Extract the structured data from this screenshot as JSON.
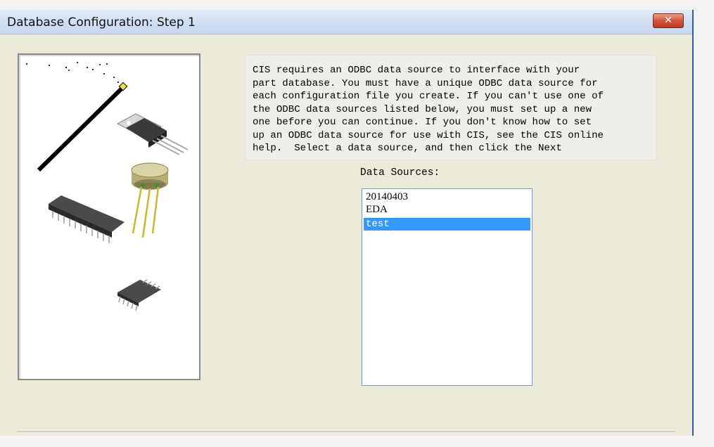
{
  "window": {
    "title": "Database Configuration: Step 1",
    "close_symbol": "✕"
  },
  "illustration": {
    "icons": [
      "magic-wand-icon",
      "to220-transistor-icon",
      "to5-transistor-icon",
      "dip-ic-chip-icon",
      "soic-chip-icon"
    ]
  },
  "description": {
    "lines": [
      "CIS requires an ODBC data source to interface with your",
      "part database. You must have a unique ODBC data source for",
      "each configuration file you create. If you can't use one of",
      "the ODBC data sources listed below, you must set up a new",
      "one before you can continue. If you don't know how to set",
      "up an ODBC data source for use with CIS, see the CIS online",
      "help.  Select a data source, and then click the Next"
    ]
  },
  "data_sources": {
    "label": "Data Sources:",
    "items": [
      "20140403",
      "EDA",
      "test"
    ],
    "selected": "test"
  },
  "colors": {
    "selection": "#3399ff",
    "dialog_bg": "#ece9d8",
    "titlebar": "#d2e0f3",
    "close_button": "#c0391f"
  }
}
